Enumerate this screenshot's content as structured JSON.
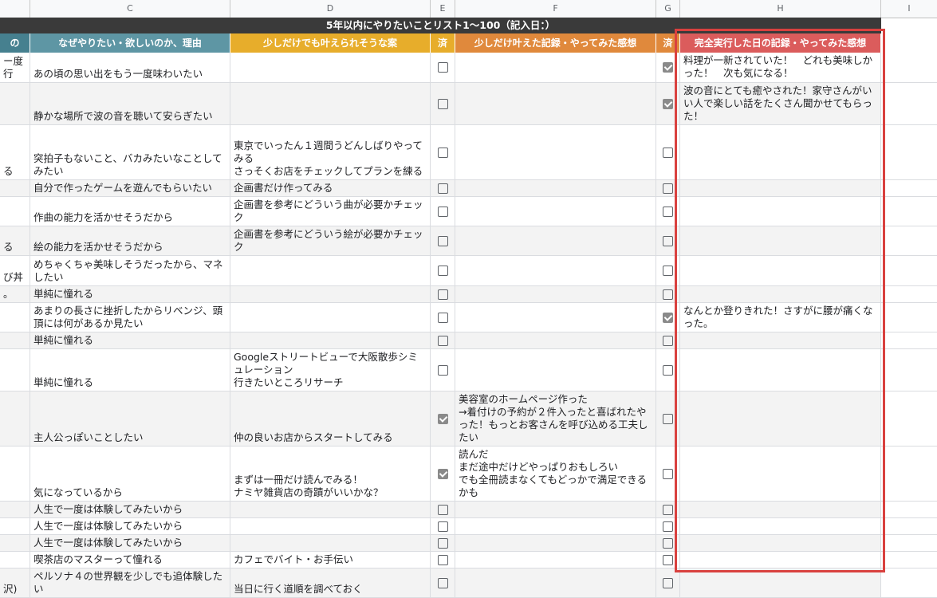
{
  "columns": [
    "C",
    "D",
    "E",
    "F",
    "G",
    "H",
    "I"
  ],
  "title": "5年以内にやりたいことリスト1〜100（記入日：）",
  "headers": [
    {
      "label": "の",
      "color": "#46808f"
    },
    {
      "label": "なぜやりたい・欲しいのか、理由",
      "color": "#5e96a4"
    },
    {
      "label": "少しだけでも叶えられそうな案",
      "color": "#e7ad2b"
    },
    {
      "label": "済",
      "color": "#e7ad2b"
    },
    {
      "label": "少しだけ叶えた記録・やってみた感想",
      "color": "#e0893c"
    },
    {
      "label": "済",
      "color": "#e0893c"
    },
    {
      "label": "完全実行した日の記録・やってみた感想",
      "color": "#db5c5c"
    }
  ],
  "rows": [
    {
      "b": "ー度行",
      "c": "あの頃の思い出をもう一度味わいたい",
      "d": "",
      "e": false,
      "f": "",
      "g": true,
      "h": "料理が一新されていた！　どれも美味しかった！　次も気になる！"
    },
    {
      "b": "",
      "c": "静かな場所で波の音を聴いて安らぎたい",
      "d": "",
      "e": false,
      "f": "",
      "g": true,
      "h": "波の音にとても癒やされた！家守さんがいい人で楽しい話をたくさん聞かせてもらった！"
    },
    {
      "b": "る",
      "c": "突拍子もないこと、バカみたいなことしてみたい",
      "d": "東京でいったん１週間うどんしばりやってみる\nさっそくお店をチェックしてプランを練る",
      "e": false,
      "f": "",
      "g": false,
      "h": ""
    },
    {
      "b": "",
      "c": "自分で作ったゲームを遊んでもらいたい",
      "d": "企画書だけ作ってみる",
      "e": false,
      "f": "",
      "g": false,
      "h": ""
    },
    {
      "b": "",
      "c": "作曲の能力を活かせそうだから",
      "d": "企画書を参考にどういう曲が必要かチェック",
      "e": false,
      "f": "",
      "g": false,
      "h": ""
    },
    {
      "b": "る",
      "c": "絵の能力を活かせそうだから",
      "d": "企画書を参考にどういう絵が必要かチェック",
      "e": false,
      "f": "",
      "g": false,
      "h": ""
    },
    {
      "b": "び丼",
      "c": "めちゃくちゃ美味しそうだったから、マネしたい",
      "d": "",
      "e": false,
      "f": "",
      "g": false,
      "h": ""
    },
    {
      "b": "。",
      "c": "単純に憧れる",
      "d": "",
      "e": false,
      "f": "",
      "g": false,
      "h": ""
    },
    {
      "b": "",
      "c": "あまりの長さに挫折したからリベンジ、頭頂には何があるか見たい",
      "d": "",
      "e": false,
      "f": "",
      "g": true,
      "h": "なんとか登りきれた！さすがに腰が痛くなった。"
    },
    {
      "b": "",
      "c": "単純に憧れる",
      "d": "",
      "e": false,
      "f": "",
      "g": false,
      "h": ""
    },
    {
      "b": "",
      "c": "単純に憧れる",
      "d": "Googleストリートビューで大阪散歩シミュレーション\n行きたいところリサーチ",
      "e": false,
      "f": "",
      "g": false,
      "h": ""
    },
    {
      "b": "",
      "c": "主人公っぽいことしたい",
      "d": "仲の良いお店からスタートしてみる",
      "e": true,
      "f": "美容室のホームページ作った\n→着付けの予約が２件入ったと喜ばれたやった！もっとお客さんを呼び込める工夫したい",
      "g": false,
      "h": ""
    },
    {
      "b": "",
      "c": "気になっているから",
      "d": "まずは一冊だけ読んでみる！\nナミヤ雑貨店の奇蹟がいいかな？",
      "e": true,
      "f": "読んだ\nまだ途中だけどやっぱりおもしろい\nでも全冊読まなくてもどっかで満足できるかも",
      "g": false,
      "h": ""
    },
    {
      "b": "",
      "c": "人生で一度は体験してみたいから",
      "d": "",
      "e": false,
      "f": "",
      "g": false,
      "h": ""
    },
    {
      "b": "",
      "c": "人生で一度は体験してみたいから",
      "d": "",
      "e": false,
      "f": "",
      "g": false,
      "h": ""
    },
    {
      "b": "",
      "c": "人生で一度は体験してみたいから",
      "d": "",
      "e": false,
      "f": "",
      "g": false,
      "h": ""
    },
    {
      "b": "",
      "c": "喫茶店のマスターって憧れる",
      "d": "カフェでバイト・お手伝い",
      "e": false,
      "f": "",
      "g": false,
      "h": ""
    },
    {
      "b": "沢)",
      "c": "ペルソナ４の世界観を少しでも追体験したい",
      "d": "当日に行く道順を調べておく",
      "e": false,
      "f": "",
      "g": false,
      "h": ""
    }
  ]
}
